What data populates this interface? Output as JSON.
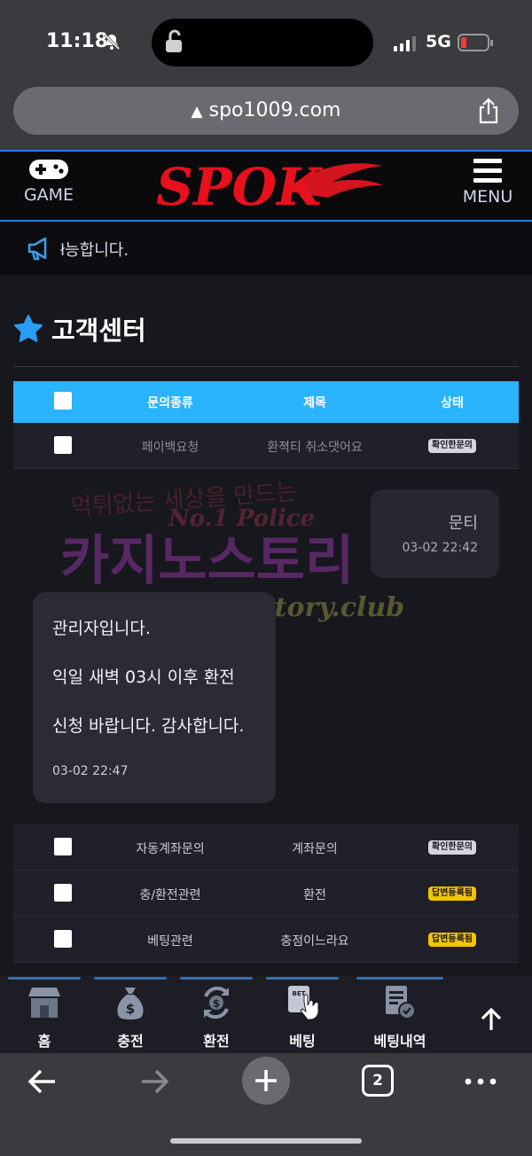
{
  "status_bar": {
    "time": "11:18",
    "network": "5G",
    "battery_level": 0.1
  },
  "address_bar": {
    "url": "spo1009.com"
  },
  "header": {
    "game_label": "GAME",
    "menu_label": "MENU",
    "logo_text": "SPOK"
  },
  "notice": {
    "text": "ł능합니다."
  },
  "page": {
    "title": "고객센터"
  },
  "table": {
    "headers": {
      "type": "문의종류",
      "title": "제목",
      "status": "상태"
    },
    "first_row": {
      "type": "페이백요청",
      "title": "환젹티 취소댓어요",
      "status": "확인한문의"
    },
    "rows": [
      {
        "type": "자동계좌문의",
        "title": "계좌문의",
        "status": "확인한문의",
        "status_color": "#d3d6de"
      },
      {
        "type": "충/환전관련",
        "title": "환전",
        "status": "답변등록됨",
        "status_color": "#f5c400"
      },
      {
        "type": "베팅관련",
        "title": "충점이느라요",
        "status": "답변등록됨",
        "status_color": "#f5c400"
      }
    ]
  },
  "chat": {
    "user_author": "문티",
    "user_time": "03-02 22:42",
    "admin_lines": [
      "관리자입니다.",
      "익일 새벽 03시 이후 환전",
      "신청 바랍니다. 감사합니다."
    ],
    "admin_time": "03-02 22:47"
  },
  "watermark": {
    "line1": "먹튀없는 세상을 만드는",
    "line2": "No.1 Police",
    "line3": "카지노스토리",
    "line4": "www.casinostory.club"
  },
  "bottom_nav": {
    "items": [
      {
        "label": "홈",
        "icon": "store-icon"
      },
      {
        "label": "충전",
        "icon": "money-bag-icon"
      },
      {
        "label": "환전",
        "icon": "exchange-icon"
      },
      {
        "label": "베팅",
        "icon": "bet-slip-icon"
      },
      {
        "label": "베팅내역",
        "icon": "history-doc-icon"
      }
    ],
    "top_icon": "arrow-up-icon"
  },
  "toolbar": {
    "tab_count": "2"
  },
  "colors": {
    "accent_blue": "#2ab3ff",
    "header_border": "#2a7fe0",
    "badge_yellow": "#f5c400"
  }
}
